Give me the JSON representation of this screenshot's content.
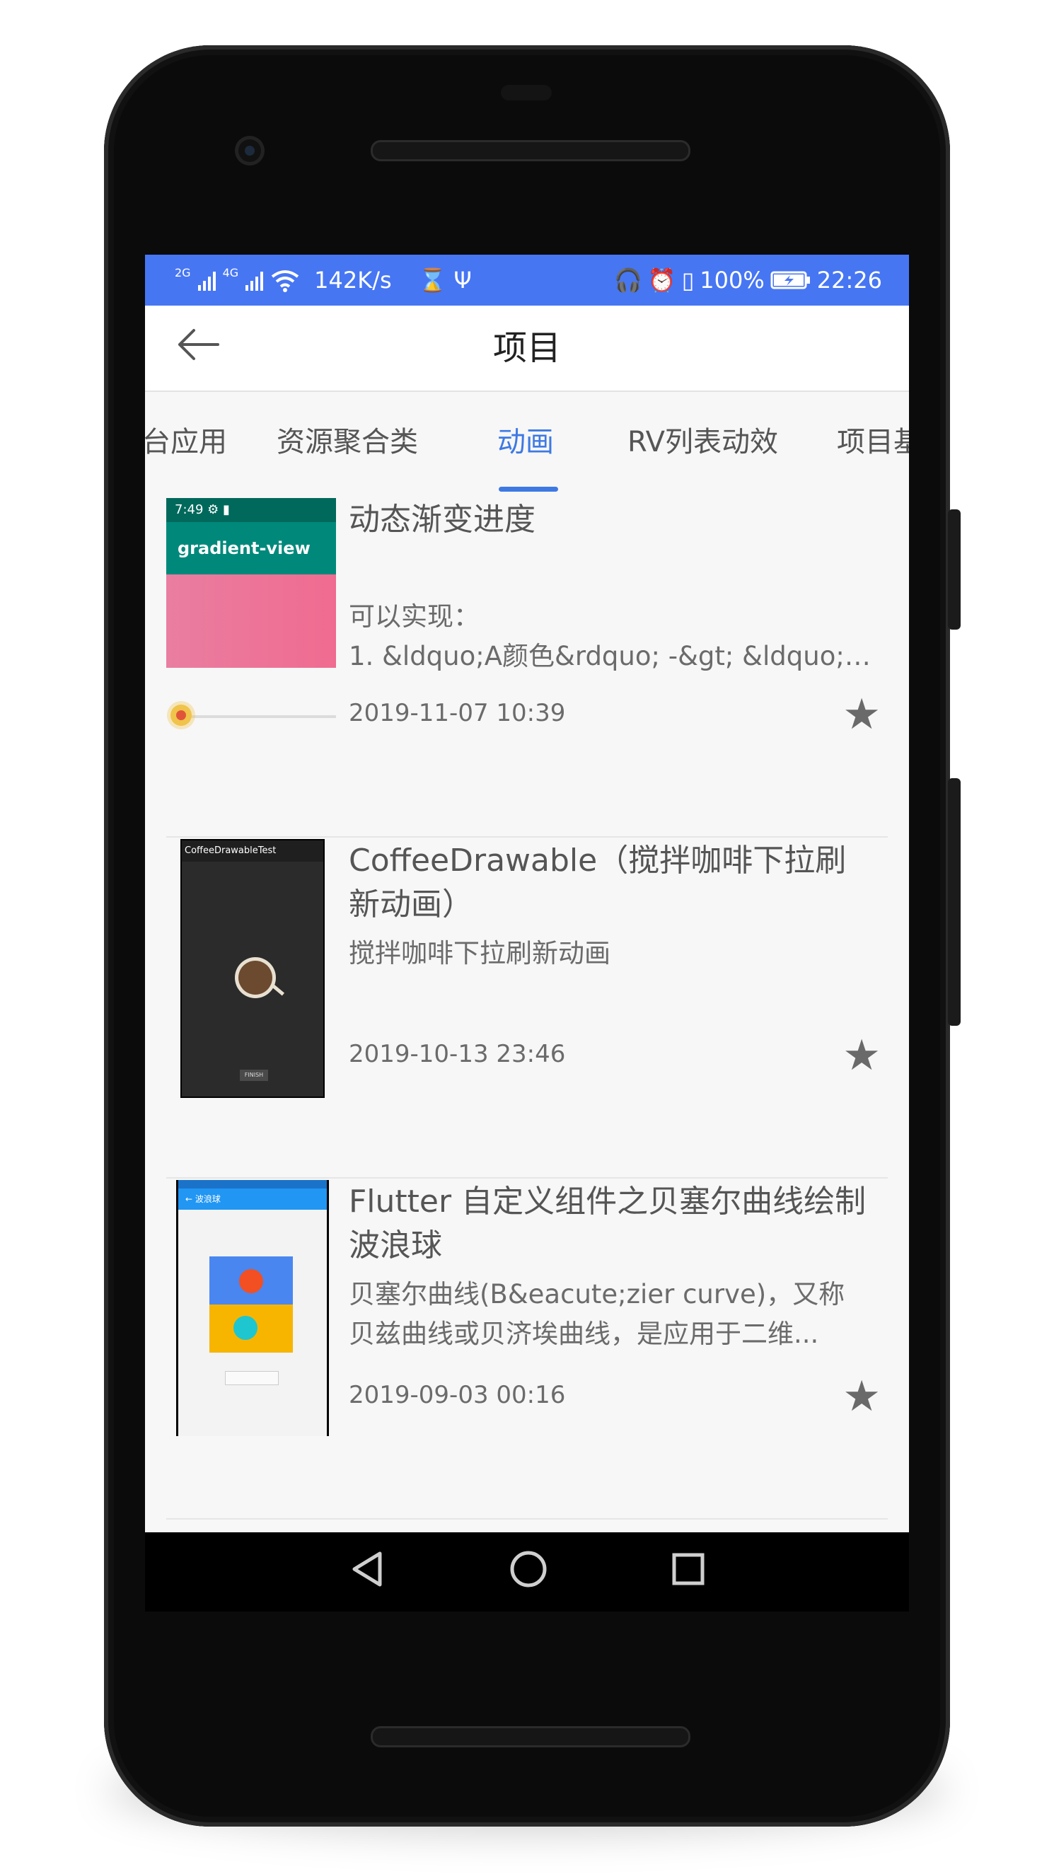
{
  "status_bar": {
    "net1": "2G",
    "net2": "4G",
    "speed": "142K/s",
    "battery": "100%",
    "time": "22:26"
  },
  "app_bar": {
    "title": "项目",
    "back_icon": "arrow-left-icon"
  },
  "tabs": [
    {
      "label": "台应用"
    },
    {
      "label": "资源聚合类"
    },
    {
      "label": "动画",
      "active": true
    },
    {
      "label": "RV列表动效"
    },
    {
      "label": "项目基"
    }
  ],
  "items": [
    {
      "title": "动态渐变进度",
      "desc_line1": "可以实现：",
      "desc_line2": "1. &ldquo;A颜色&rdquo;  -&gt; &ldquo;B...",
      "date": "2019-11-07 10:39",
      "thumb": {
        "time": "7:49",
        "label": "gradient-view"
      }
    },
    {
      "title": "CoffeeDrawable（搅拌咖啡下拉刷新动画）",
      "desc_line1": "搅拌咖啡下拉刷新动画",
      "date": "2019-10-13 23:46",
      "thumb": {
        "label": "CoffeeDrawableTest",
        "button": "FINISH"
      }
    },
    {
      "title": "Flutter 自定义组件之贝塞尔曲线绘制波浪球",
      "desc_line1": "贝塞尔曲线(B&eacute;zier curve)，又称",
      "desc_line2": "贝兹曲线或贝济埃曲线，是应用于二维...",
      "date": "2019-09-03 00:16",
      "thumb": {
        "label": "波浪球"
      }
    }
  ],
  "colors": {
    "accent": "#3e79e3",
    "status_bar": "#4776f3"
  }
}
